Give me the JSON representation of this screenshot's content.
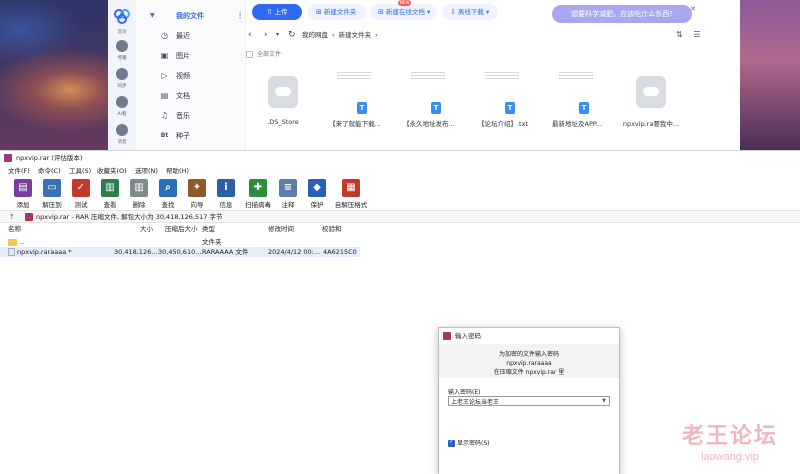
{
  "colors": {
    "accent": "#2f6bf0",
    "netdisk_bubble": "#a9a7ef",
    "selected_row": "#e5eefb",
    "checkbox": "#2a5fd6",
    "watermark": "#e6788c"
  },
  "netdisk": {
    "rail": [
      {
        "label": "首页",
        "icon": "home-icon"
      },
      {
        "label": "传输",
        "icon": "transfer-icon"
      },
      {
        "label": "同步",
        "icon": "sync-icon"
      },
      {
        "label": "AI看",
        "icon": "ai-icon"
      },
      {
        "label": "消息",
        "icon": "message-icon"
      }
    ],
    "tree": {
      "root_label": "我的文件",
      "items": [
        {
          "label": "最近",
          "icon": "clock-icon",
          "glyph": "◷"
        },
        {
          "label": "图片",
          "icon": "image-icon",
          "glyph": "▣"
        },
        {
          "label": "视频",
          "icon": "video-icon",
          "glyph": "▷"
        },
        {
          "label": "文档",
          "icon": "document-icon",
          "glyph": "▤"
        },
        {
          "label": "音乐",
          "icon": "music-icon",
          "glyph": "♫"
        },
        {
          "label": "种子",
          "icon": "torrent-icon",
          "glyph": "Bt"
        }
      ]
    },
    "toolbar": {
      "upload": "上传",
      "new_folder": "新建文件夹",
      "new_online": "新建在线文档",
      "new_badge": "NEW",
      "offline_download": "离线下载"
    },
    "ai_bubble": "想要科学减肥，应该吃什么东西?",
    "breadcrumb": [
      "我的网盘",
      "新建文件夹"
    ],
    "select_all": "全部文件",
    "files": [
      {
        "name": ".DS_Store",
        "thumb": "cloud"
      },
      {
        "name": "【来了就能下载...",
        "thumb": "doc"
      },
      {
        "name": "【永久地址发布...",
        "thumb": "doc"
      },
      {
        "name": "【论坛介绍】.txt",
        "thumb": "doc"
      },
      {
        "name": "最新地址及APP...",
        "thumb": "doc"
      },
      {
        "name": "npxvip.ra要我中...",
        "thumb": "cloud"
      }
    ]
  },
  "winrar": {
    "title": "npxvip.rar (评估版本)",
    "menu": [
      "文件(F)",
      "命令(C)",
      "工具(S)",
      "收藏夹(O)",
      "选项(N)",
      "帮助(H)"
    ],
    "toolbar": [
      {
        "label": "添加",
        "icon": "add-icon",
        "color": "#7a3d9e",
        "glyph": "▤"
      },
      {
        "label": "解压到",
        "icon": "extract-icon",
        "color": "#3b6fb6",
        "glyph": "▭"
      },
      {
        "label": "测试",
        "icon": "test-icon",
        "color": "#c0392b",
        "glyph": "✓"
      },
      {
        "label": "查看",
        "icon": "view-icon",
        "color": "#2e7d4f",
        "glyph": "▥"
      },
      {
        "label": "删除",
        "icon": "delete-icon",
        "color": "#7f8c8d",
        "glyph": "▥"
      },
      {
        "label": "查找",
        "icon": "find-icon",
        "color": "#2a6fbd",
        "glyph": "⌕"
      },
      {
        "label": "向导",
        "icon": "wizard-icon",
        "color": "#8e5a2b",
        "glyph": "✦"
      },
      {
        "label": "信息",
        "icon": "info-icon",
        "color": "#2d5fa8",
        "glyph": "i"
      },
      {
        "label": "扫描病毒",
        "icon": "scan-virus-icon",
        "color": "#2e8b3a",
        "glyph": "✚"
      },
      {
        "label": "注释",
        "icon": "comment-icon",
        "color": "#5a7fa8",
        "glyph": "≡"
      },
      {
        "label": "保护",
        "icon": "protect-icon",
        "color": "#2a5fb8",
        "glyph": "◆"
      },
      {
        "label": "自解压格式",
        "icon": "sfx-icon",
        "color": "#c0392b",
        "glyph": "▦"
      }
    ],
    "path": "npxvip.rar - RAR 压缩文件, 解包大小为 30,418,126,517 字节",
    "columns": {
      "name": "名称",
      "size": "大小",
      "packed": "压缩后大小",
      "type": "类型",
      "modified": "修改时间",
      "crc": "校验和"
    },
    "rows": [
      {
        "name": "..",
        "size": "",
        "packed": "",
        "type": "文件夹",
        "modified": "",
        "crc": ""
      },
      {
        "name": "npxvip.raraaaa *",
        "size": "30,418,126...",
        "packed": "30,450,610...",
        "type": "RARAAAA 文件",
        "modified": "2024/4/12 00:...",
        "crc": "4A6215C0"
      }
    ]
  },
  "password_dialog": {
    "title": "输入密码",
    "info_line1": "为加密的文件输入密码",
    "info_line2": "npxvip.raraaaa",
    "info_line3": "在压缩文件 npxvip.rar 里",
    "label": "输入密码(E)",
    "value": "上老王论坛当老王",
    "show_password": "显示密码(S)"
  },
  "watermark": {
    "cn": "老王论坛",
    "en": "laowang.vip"
  }
}
